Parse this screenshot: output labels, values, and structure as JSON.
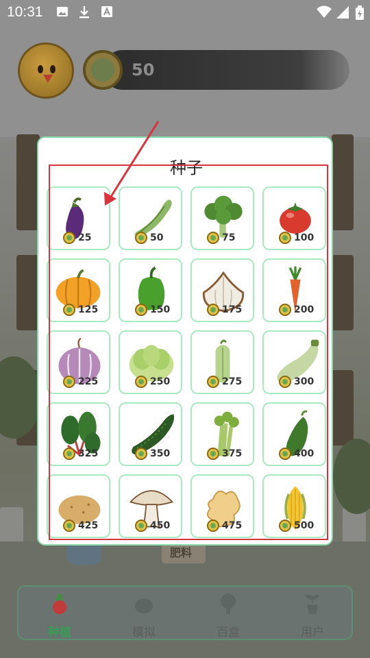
{
  "status_bar": {
    "time": "10:31",
    "left_icons": [
      "image-icon",
      "download-icon",
      "font-icon"
    ],
    "right_icons": [
      "wifi-icon",
      "signal-icon",
      "battery-charging-icon"
    ]
  },
  "header": {
    "avatar_icon": "chick-avatar-icon",
    "currency_icon": "cabbage-coin-icon",
    "coin_count": "50"
  },
  "modal": {
    "title": "种子",
    "seeds": [
      {
        "name": "eggplant",
        "price": "25",
        "icon": "eggplant-icon"
      },
      {
        "name": "pea",
        "price": "50",
        "icon": "pea-pod-icon"
      },
      {
        "name": "broccoli",
        "price": "75",
        "icon": "broccoli-icon"
      },
      {
        "name": "tomato",
        "price": "100",
        "icon": "tomato-icon"
      },
      {
        "name": "pumpkin",
        "price": "125",
        "icon": "pumpkin-icon"
      },
      {
        "name": "pepper",
        "price": "150",
        "icon": "bell-pepper-icon"
      },
      {
        "name": "garlic",
        "price": "175",
        "icon": "garlic-icon"
      },
      {
        "name": "carrot",
        "price": "200",
        "icon": "carrot-icon"
      },
      {
        "name": "onion",
        "price": "225",
        "icon": "onion-icon"
      },
      {
        "name": "lettuce",
        "price": "250",
        "icon": "lettuce-icon"
      },
      {
        "name": "small-cucumber",
        "price": "275",
        "icon": "small-cucumber-icon"
      },
      {
        "name": "zucchini",
        "price": "300",
        "icon": "zucchini-icon"
      },
      {
        "name": "chard",
        "price": "325",
        "icon": "chard-icon"
      },
      {
        "name": "cucumber",
        "price": "350",
        "icon": "cucumber-icon"
      },
      {
        "name": "celery",
        "price": "375",
        "icon": "celery-icon"
      },
      {
        "name": "gherkin",
        "price": "400",
        "icon": "gherkin-icon"
      },
      {
        "name": "potato",
        "price": "425",
        "icon": "potato-icon"
      },
      {
        "name": "mushroom",
        "price": "450",
        "icon": "mushroom-icon"
      },
      {
        "name": "ginger",
        "price": "475",
        "icon": "ginger-icon"
      },
      {
        "name": "corn",
        "price": "500",
        "icon": "corn-icon"
      }
    ]
  },
  "background": {
    "fertilizer_label": "肥料"
  },
  "bottom_nav": {
    "items": [
      {
        "label": "种植",
        "icon": "radish-icon",
        "active": true
      },
      {
        "label": "模拟",
        "icon": "sphere-icon",
        "active": false
      },
      {
        "label": "百盒",
        "icon": "tree-icon",
        "active": false
      },
      {
        "label": "用户",
        "icon": "sprout-pot-icon",
        "active": false
      }
    ]
  },
  "colors": {
    "tile_border": "#a7e9c0",
    "modal_border": "#89d7a8",
    "highlight": "#d9343c",
    "active_nav": "#3a9a56"
  }
}
